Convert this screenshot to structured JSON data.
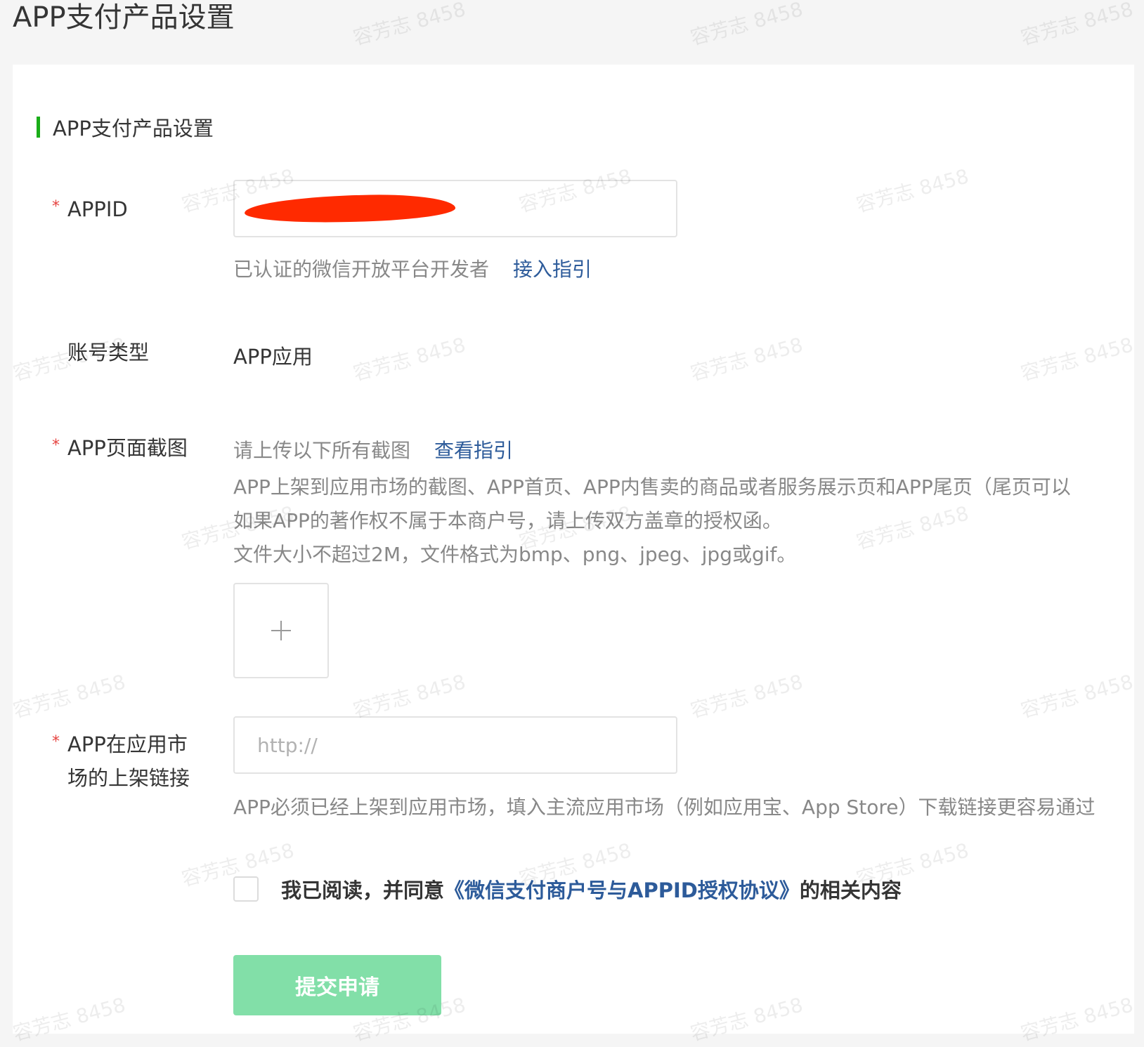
{
  "page": {
    "title": "APP支付产品设置"
  },
  "section": {
    "heading": "APP支付产品设置"
  },
  "appid": {
    "required_mark": "*",
    "label": "APPID",
    "value": "",
    "hint": "已认证的微信开放平台开发者",
    "link": "接入指引"
  },
  "account_type": {
    "label": "账号类型",
    "value": "APP应用"
  },
  "screenshots": {
    "required_mark": "*",
    "label": "APP页面截图",
    "hint": "请上传以下所有截图",
    "link": "查看指引",
    "desc_1": "APP上架到应用市场的截图、APP首页、APP内售卖的商品或者服务展示页和APP尾页（尾页可以",
    "desc_2": "如果APP的著作权不属于本商户号，请上传双方盖章的授权函。",
    "desc_3": "文件大小不超过2M，文件格式为bmp、png、jpeg、jpg或gif。",
    "upload_icon": "plus-icon"
  },
  "market_link": {
    "required_mark": "*",
    "label_line1": "APP在应用市",
    "label_line2": "场的上架链接",
    "placeholder": "http://",
    "hint": "APP必须已经上架到应用市场，填入主流应用市场（例如应用宝、App Store）下载链接更容易通过"
  },
  "agreement": {
    "prefix": "我已阅读，并同意",
    "link": "《微信支付商户号与APPID授权协议》",
    "suffix": "的相关内容"
  },
  "submit": {
    "label": "提交申请"
  },
  "watermark": {
    "text": "容芳志 8458"
  },
  "colors": {
    "accent": "#1aad19",
    "link": "#2d5b9a",
    "required": "#e64340",
    "submit_disabled": "#82dfa8",
    "redaction": "#ff2a00"
  }
}
